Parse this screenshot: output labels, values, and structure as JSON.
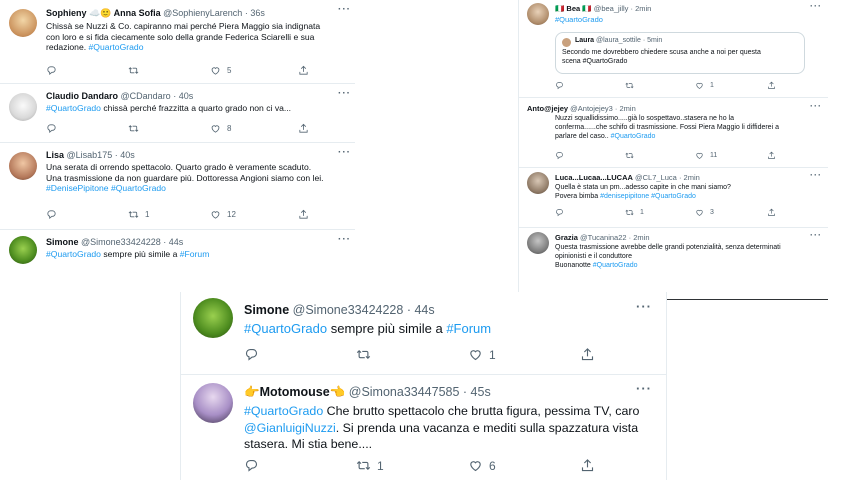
{
  "left_panel": {
    "tweets": [
      {
        "name": "Sophieny ☁️🙂 Anna Sofia",
        "handle": "@SophienyLarench",
        "time": "· 36s",
        "text_parts": [
          "Chissà se Nuzzi & Co. capiranno mai perché Piera Maggio sia indignata",
          "con loro e si fida ciecamente solo della grande Federica Sciarelli e sua",
          "redazione. "
        ],
        "hashtag": "#QuartoGrado",
        "replies": "",
        "retweets": "",
        "likes": "5"
      },
      {
        "name": "Claudio Dandaro",
        "handle": "@CDandaro",
        "time": "· 40s",
        "hashtag": "#QuartoGrado",
        "text": " chissà perché frazzitta a quarto grado non ci va...",
        "likes": "8"
      },
      {
        "name": "Lisa",
        "handle": "@Lisab175",
        "time": "· 40s",
        "lines": [
          "Una serata di orrendo spettacolo.  Quarto grado è veramente scaduto.",
          "Una trasmissione da non guardare più. Dottoressa Angioni siamo con lei."
        ],
        "hashtags": "#DenisePipitone #QuartoGrado",
        "retweets": "1",
        "likes": "12"
      },
      {
        "name": "Simone",
        "handle": "@Simone33424228",
        "time": "· 44s",
        "hashtag": "#QuartoGrado",
        "text": " sempre più simile a ",
        "hashtag2": "#Forum"
      }
    ]
  },
  "right_panel": {
    "tweets": [
      {
        "name": "🇮🇹 Bea 🇮🇹",
        "handle": "@bea_jilly",
        "time": "· 2min",
        "hashtag": "#QuartoGrado",
        "quote": {
          "name": "Laura",
          "handle": "@laura_sottile",
          "time": "· 5min",
          "lines": [
            "Secondo me dovrebbero chiedere scusa anche a noi per questa",
            "scena #QuartoGrado"
          ]
        },
        "likes": "1"
      },
      {
        "name": "Anto@jejey",
        "handle": "@Antojejey3",
        "time": "· 2min",
        "lines": [
          "Nuzzi squallidissimo.....già lo sospettavo..stasera ne ho la",
          "conferma......che schifo di trasmissione. Fossi Piera Maggio li diffiderei a",
          "parlare del caso.. "
        ],
        "hashtag": "#QuartoGrado",
        "likes": "11"
      },
      {
        "name": "Luca...Lucaa...LUCAA",
        "handle": "@CL7_Luca",
        "time": "· 2min",
        "lines": [
          "Quella è stata un pm...adesso capite in che mani siamo?",
          "Povera bimba "
        ],
        "hashtags": "#denisepipitone #QuartoGrado",
        "retweets": "1",
        "likes": "3"
      },
      {
        "name": "Grazia",
        "handle": "@Tucanina22",
        "time": "· 2min",
        "lines": [
          "Questa trasmissione avrebbe delle grandi potenzialità, senza determinati",
          "opinionisti e il conduttore",
          "Buonanotte "
        ],
        "hashtag": "#QuartoGrado"
      }
    ]
  },
  "bottom_panel": {
    "tweets": [
      {
        "name": "Simone",
        "handle": "@Simone33424228",
        "time": "· 44s",
        "hashtag": "#QuartoGrado",
        "text": " sempre più simile a ",
        "hashtag2": "#Forum",
        "likes": "1"
      },
      {
        "name": "👉Motomouse👈",
        "handle": "@Simona33447585",
        "time": "· 45s",
        "hashtag": "#QuartoGrado",
        "text1": " Che brutto spettacolo che brutta figura, pessima TV, caro",
        "mention": "@GianluigiNuzzi",
        "text2": ". Si prenda una vacanza e mediti sulla spazzatura vista",
        "text3": "stasera. Mi stia bene....",
        "retweets": "1",
        "likes": "6"
      }
    ]
  },
  "icons": {
    "more": "more-icon",
    "reply": "reply-icon",
    "retweet": "retweet-icon",
    "like": "like-icon",
    "share": "share-icon"
  },
  "colors": {
    "accent": "#1d9bf0",
    "text": "#0f1419",
    "muted": "#536471",
    "border": "#e6ecf0"
  }
}
